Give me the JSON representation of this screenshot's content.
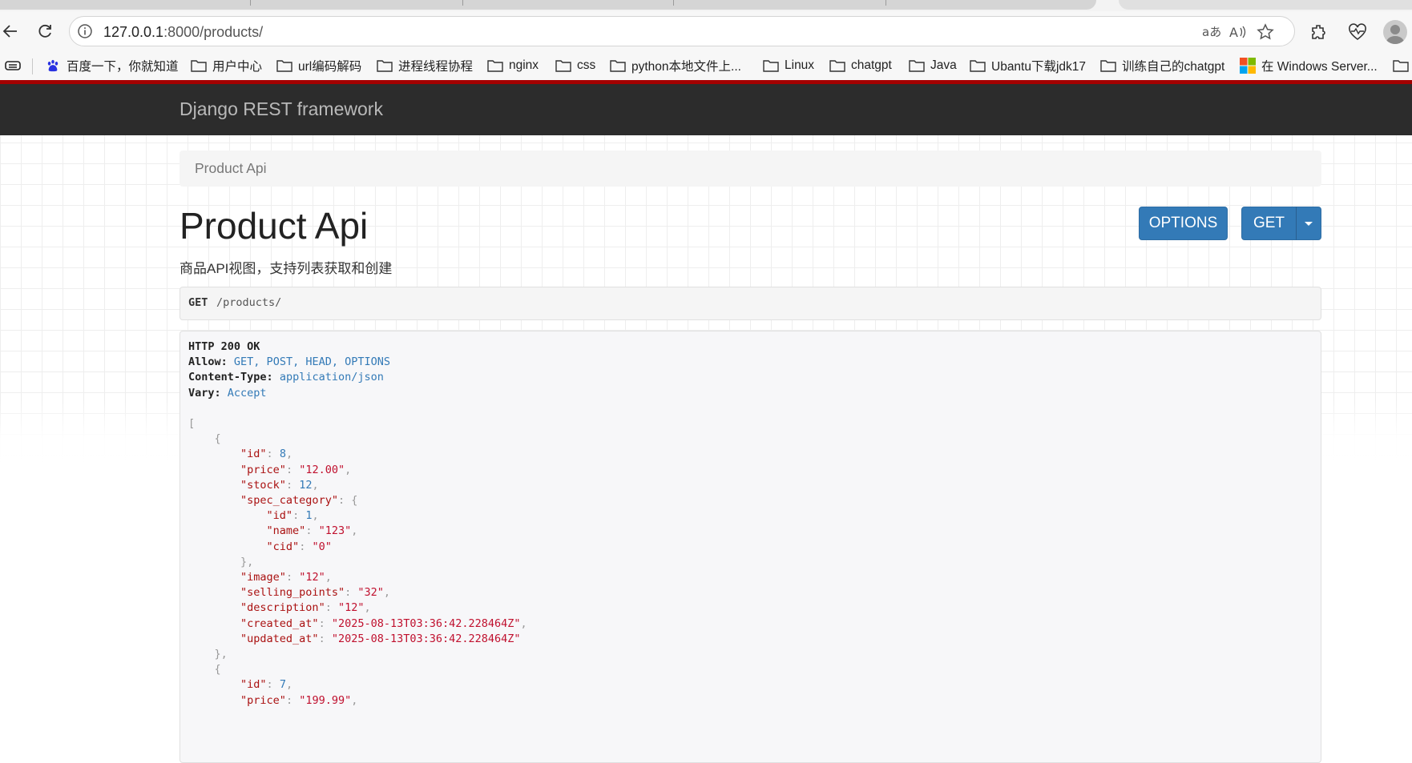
{
  "browser": {
    "url_host": "127.0.0.1",
    "url_rest": ":8000/products/",
    "bookmarks": [
      {
        "label": "百度一下，你就知道",
        "icon": "baidu-icon"
      },
      {
        "label": "用户中心",
        "icon": "folder-icon"
      },
      {
        "label": "url编码解码",
        "icon": "folder-icon"
      },
      {
        "label": "进程线程协程",
        "icon": "folder-icon"
      },
      {
        "label": "nginx",
        "icon": "folder-icon"
      },
      {
        "label": "css",
        "icon": "folder-icon"
      },
      {
        "label": "python本地文件上...",
        "icon": "folder-icon"
      },
      {
        "label": "Linux",
        "icon": "folder-icon"
      },
      {
        "label": "chatgpt",
        "icon": "folder-icon"
      },
      {
        "label": "Java",
        "icon": "folder-icon"
      },
      {
        "label": "Ubantu下载jdk17",
        "icon": "folder-icon"
      },
      {
        "label": "训练自己的chatgpt",
        "icon": "folder-icon"
      },
      {
        "label": "在 Windows Server...",
        "icon": "windows-icon"
      }
    ]
  },
  "navbar": {
    "brand": "Django REST framework"
  },
  "breadcrumb": {
    "current": "Product Api"
  },
  "page": {
    "title": "Product Api",
    "description": "商品API视图，支持列表获取和创建",
    "options_label": "OPTIONS",
    "get_label": "GET"
  },
  "request": {
    "method": "GET",
    "path": "/products/"
  },
  "response": {
    "status": "HTTP 200 OK",
    "headers": [
      {
        "key": "Allow:",
        "value": "GET, POST, HEAD, OPTIONS"
      },
      {
        "key": "Content-Type:",
        "value": "application/json"
      },
      {
        "key": "Vary:",
        "value": "Accept"
      }
    ],
    "body_lines": [
      [
        {
          "t": "[",
          "c": "pun"
        }
      ],
      [
        {
          "t": "    {",
          "c": "pun"
        }
      ],
      [
        {
          "t": "        "
        },
        {
          "t": "\"id\"",
          "c": "key"
        },
        {
          "t": ": ",
          "c": "pun"
        },
        {
          "t": "8",
          "c": "num"
        },
        {
          "t": ",",
          "c": "pun"
        }
      ],
      [
        {
          "t": "        "
        },
        {
          "t": "\"price\"",
          "c": "key"
        },
        {
          "t": ": ",
          "c": "pun"
        },
        {
          "t": "\"12.00\"",
          "c": "str"
        },
        {
          "t": ",",
          "c": "pun"
        }
      ],
      [
        {
          "t": "        "
        },
        {
          "t": "\"stock\"",
          "c": "key"
        },
        {
          "t": ": ",
          "c": "pun"
        },
        {
          "t": "12",
          "c": "num"
        },
        {
          "t": ",",
          "c": "pun"
        }
      ],
      [
        {
          "t": "        "
        },
        {
          "t": "\"spec_category\"",
          "c": "key"
        },
        {
          "t": ": {",
          "c": "pun"
        }
      ],
      [
        {
          "t": "            "
        },
        {
          "t": "\"id\"",
          "c": "key"
        },
        {
          "t": ": ",
          "c": "pun"
        },
        {
          "t": "1",
          "c": "num"
        },
        {
          "t": ",",
          "c": "pun"
        }
      ],
      [
        {
          "t": "            "
        },
        {
          "t": "\"name\"",
          "c": "key"
        },
        {
          "t": ": ",
          "c": "pun"
        },
        {
          "t": "\"123\"",
          "c": "str"
        },
        {
          "t": ",",
          "c": "pun"
        }
      ],
      [
        {
          "t": "            "
        },
        {
          "t": "\"cid\"",
          "c": "key"
        },
        {
          "t": ": ",
          "c": "pun"
        },
        {
          "t": "\"0\"",
          "c": "str"
        }
      ],
      [
        {
          "t": "        },",
          "c": "pun"
        }
      ],
      [
        {
          "t": "        "
        },
        {
          "t": "\"image\"",
          "c": "key"
        },
        {
          "t": ": ",
          "c": "pun"
        },
        {
          "t": "\"12\"",
          "c": "str"
        },
        {
          "t": ",",
          "c": "pun"
        }
      ],
      [
        {
          "t": "        "
        },
        {
          "t": "\"selling_points\"",
          "c": "key"
        },
        {
          "t": ": ",
          "c": "pun"
        },
        {
          "t": "\"32\"",
          "c": "str"
        },
        {
          "t": ",",
          "c": "pun"
        }
      ],
      [
        {
          "t": "        "
        },
        {
          "t": "\"description\"",
          "c": "key"
        },
        {
          "t": ": ",
          "c": "pun"
        },
        {
          "t": "\"12\"",
          "c": "str"
        },
        {
          "t": ",",
          "c": "pun"
        }
      ],
      [
        {
          "t": "        "
        },
        {
          "t": "\"created_at\"",
          "c": "key"
        },
        {
          "t": ": ",
          "c": "pun"
        },
        {
          "t": "\"2025-08-13T03:36:42.228464Z\"",
          "c": "str"
        },
        {
          "t": ",",
          "c": "pun"
        }
      ],
      [
        {
          "t": "        "
        },
        {
          "t": "\"updated_at\"",
          "c": "key"
        },
        {
          "t": ": ",
          "c": "pun"
        },
        {
          "t": "\"2025-08-13T03:36:42.228464Z\"",
          "c": "str"
        }
      ],
      [
        {
          "t": "    },",
          "c": "pun"
        }
      ],
      [
        {
          "t": "    {",
          "c": "pun"
        }
      ],
      [
        {
          "t": "        "
        },
        {
          "t": "\"id\"",
          "c": "key"
        },
        {
          "t": ": ",
          "c": "pun"
        },
        {
          "t": "7",
          "c": "num"
        },
        {
          "t": ",",
          "c": "pun"
        }
      ],
      [
        {
          "t": "        "
        },
        {
          "t": "\"price\"",
          "c": "key"
        },
        {
          "t": ": ",
          "c": "pun"
        },
        {
          "t": "\"199.99\"",
          "c": "str"
        },
        {
          "t": ",",
          "c": "pun"
        }
      ]
    ]
  }
}
